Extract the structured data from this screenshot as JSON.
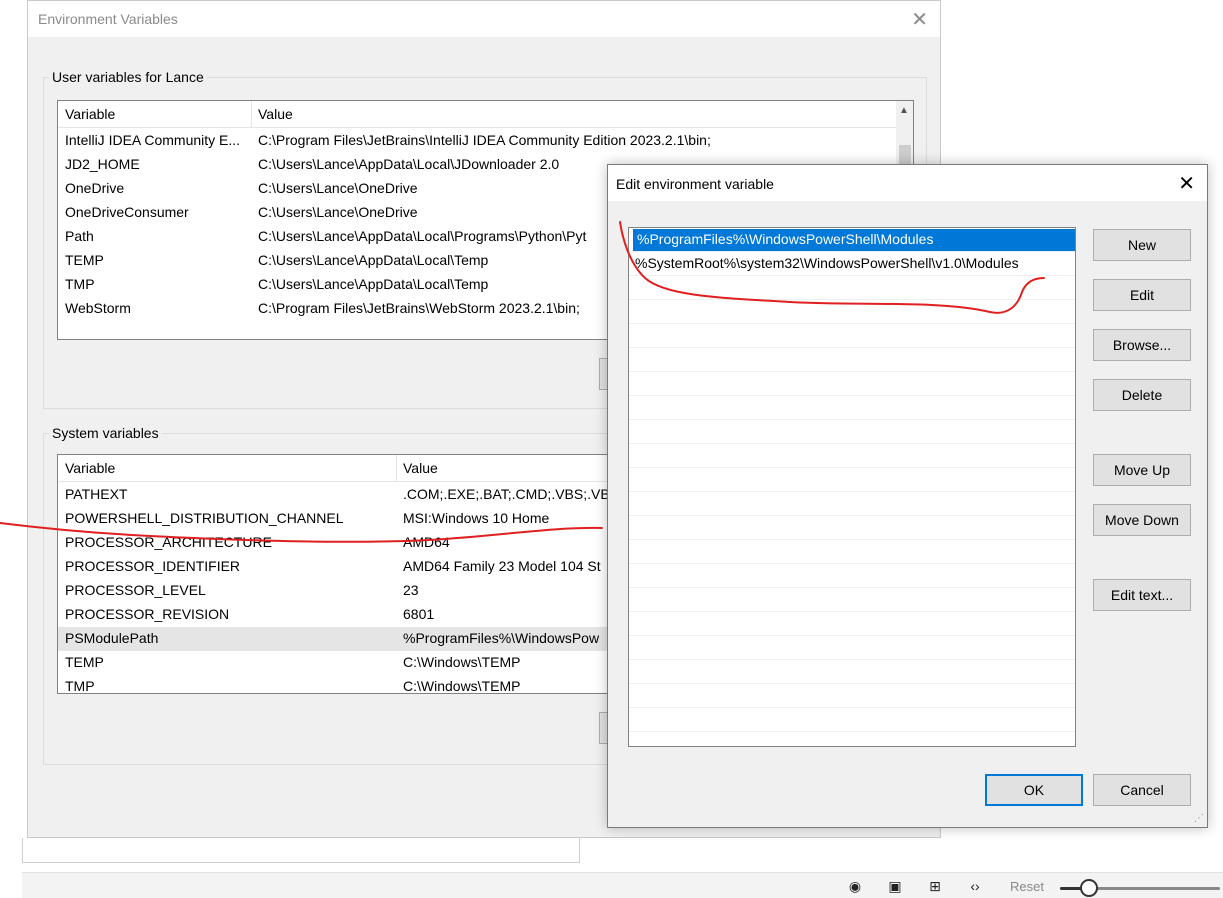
{
  "background": {
    "bottom_toolbar": {
      "icons": [
        "camera-icon",
        "image-icon",
        "grid-icon",
        "code-icon"
      ],
      "reset_label": "Reset",
      "zoom_level": 0.18
    }
  },
  "env_dialog": {
    "title": "Environment Variables",
    "user_group_label": "User variables for Lance",
    "user_columns": [
      "Variable",
      "Value"
    ],
    "user_rows": [
      {
        "variable": "IntelliJ IDEA Community E...",
        "value": "C:\\Program Files\\JetBrains\\IntelliJ IDEA Community Edition 2023.2.1\\bin;"
      },
      {
        "variable": "JD2_HOME",
        "value": "C:\\Users\\Lance\\AppData\\Local\\JDownloader 2.0"
      },
      {
        "variable": "OneDrive",
        "value": "C:\\Users\\Lance\\OneDrive"
      },
      {
        "variable": "OneDriveConsumer",
        "value": "C:\\Users\\Lance\\OneDrive"
      },
      {
        "variable": "Path",
        "value": "C:\\Users\\Lance\\AppData\\Local\\Programs\\Python\\Pyt"
      },
      {
        "variable": "TEMP",
        "value": "C:\\Users\\Lance\\AppData\\Local\\Temp"
      },
      {
        "variable": "TMP",
        "value": "C:\\Users\\Lance\\AppData\\Local\\Temp"
      },
      {
        "variable": "WebStorm",
        "value": "C:\\Program Files\\JetBrains\\WebStorm 2023.2.1\\bin;"
      }
    ],
    "system_group_label": "System variables",
    "system_columns": [
      "Variable",
      "Value"
    ],
    "system_rows": [
      {
        "variable": "PATHEXT",
        "value": ".COM;.EXE;.BAT;.CMD;.VBS;.VBE;"
      },
      {
        "variable": "POWERSHELL_DISTRIBUTION_CHANNEL",
        "value": "MSI:Windows 10 Home"
      },
      {
        "variable": "PROCESSOR_ARCHITECTURE",
        "value": "AMD64"
      },
      {
        "variable": "PROCESSOR_IDENTIFIER",
        "value": "AMD64 Family 23 Model 104 St"
      },
      {
        "variable": "PROCESSOR_LEVEL",
        "value": "23"
      },
      {
        "variable": "PROCESSOR_REVISION",
        "value": "6801"
      },
      {
        "variable": "PSModulePath",
        "value": "%ProgramFiles%\\WindowsPow"
      },
      {
        "variable": "TEMP",
        "value": "C:\\Windows\\TEMP"
      },
      {
        "variable": "TMP",
        "value": "C:\\Windows\\TEMP"
      }
    ],
    "system_selected_index": 6
  },
  "edit_dialog": {
    "title": "Edit environment variable",
    "entries": [
      "%ProgramFiles%\\WindowsPowerShell\\Modules",
      "%SystemRoot%\\system32\\WindowsPowerShell\\v1.0\\Modules"
    ],
    "selected_index": 0,
    "buttons": {
      "new": "New",
      "edit": "Edit",
      "browse": "Browse...",
      "delete": "Delete",
      "move_up": "Move Up",
      "move_down": "Move Down",
      "edit_text": "Edit text...",
      "ok": "OK",
      "cancel": "Cancel"
    },
    "selection_color": "#0078d7"
  },
  "annotation_color": "#e02020"
}
